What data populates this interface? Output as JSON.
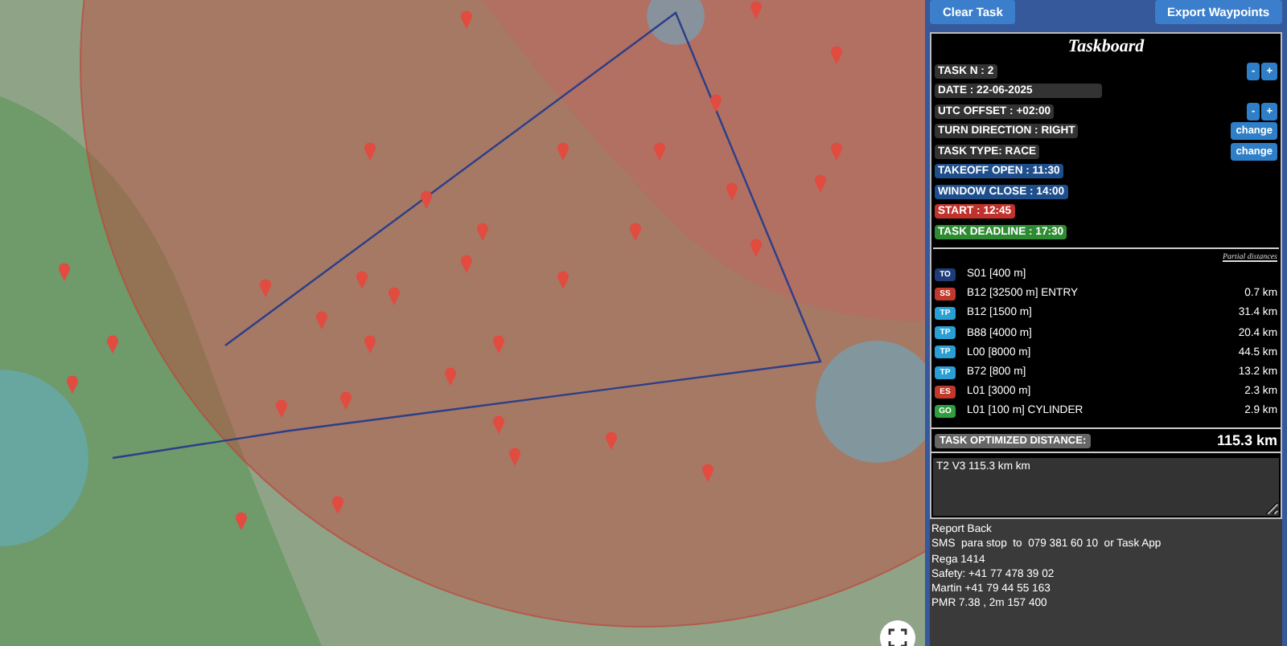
{
  "toolbar": {
    "buttons": [
      "Clear Task",
      "Export Waypoints"
    ]
  },
  "taskboard": {
    "title": "Taskboard",
    "fields": [
      {
        "label": "TASK N : 2",
        "kind": "plain",
        "controls": [
          "-",
          "+"
        ]
      },
      {
        "label": "DATE : 22-06-2025",
        "kind": "wide"
      },
      {
        "label": "UTC OFFSET : +02:00",
        "kind": "plain",
        "controls": [
          "-",
          "+"
        ]
      },
      {
        "label": "TURN DIRECTION : RIGHT",
        "kind": "plain",
        "controls": [
          "change"
        ]
      },
      {
        "label": "TASK TYPE: RACE",
        "kind": "plain",
        "controls": [
          "change"
        ]
      },
      {
        "label": "TAKEOFF OPEN : 11:30",
        "kind": "blue"
      },
      {
        "label": "WINDOW CLOSE : 14:00",
        "kind": "blue"
      },
      {
        "label": "START : 12:45",
        "kind": "red"
      },
      {
        "label": "TASK DEADLINE : 17:30",
        "kind": "green"
      }
    ],
    "distances_header": "Partial distances",
    "legs": [
      {
        "tag": "TO",
        "color": "#1d3c78",
        "name": "S01 [400 m]"
      },
      {
        "tag": "SS",
        "color": "#c0392b",
        "name": "B12 [32500 m] ENTRY",
        "distance": "0.7 km"
      },
      {
        "tag": "TP",
        "color": "#2a9fd6",
        "name": "B12 [1500 m]",
        "distance": "31.4 km"
      },
      {
        "tag": "TP",
        "color": "#2a9fd6",
        "name": "B88 [4000 m]",
        "distance": "20.4 km"
      },
      {
        "tag": "TP",
        "color": "#2a9fd6",
        "name": "L00 [8000 m]",
        "distance": "44.5 km"
      },
      {
        "tag": "TP",
        "color": "#2a9fd6",
        "name": "B72 [800 m]",
        "distance": "13.2 km"
      },
      {
        "tag": "ES",
        "color": "#c0392b",
        "name": "L01 [3000 m]",
        "distance": "2.3 km"
      },
      {
        "tag": "GO",
        "color": "#2e9e3e",
        "name": "L01 [100 m] CYLINDER",
        "distance": "2.9 km"
      }
    ],
    "optimized": {
      "label": "TASK OPTIMIZED DISTANCE:",
      "value": "115.3 km"
    },
    "notes": {
      "value": "T2 V3 115.3 km km"
    }
  },
  "report": [
    "Report Back",
    "SMS  para stop  to  079 381 60 10  or Task App",
    "Rega 1414",
    "Safety: +41 77 478 39 02",
    "Martin +41 79 44 55 163",
    "PMR 7.38 , 2m 157 400"
  ]
}
